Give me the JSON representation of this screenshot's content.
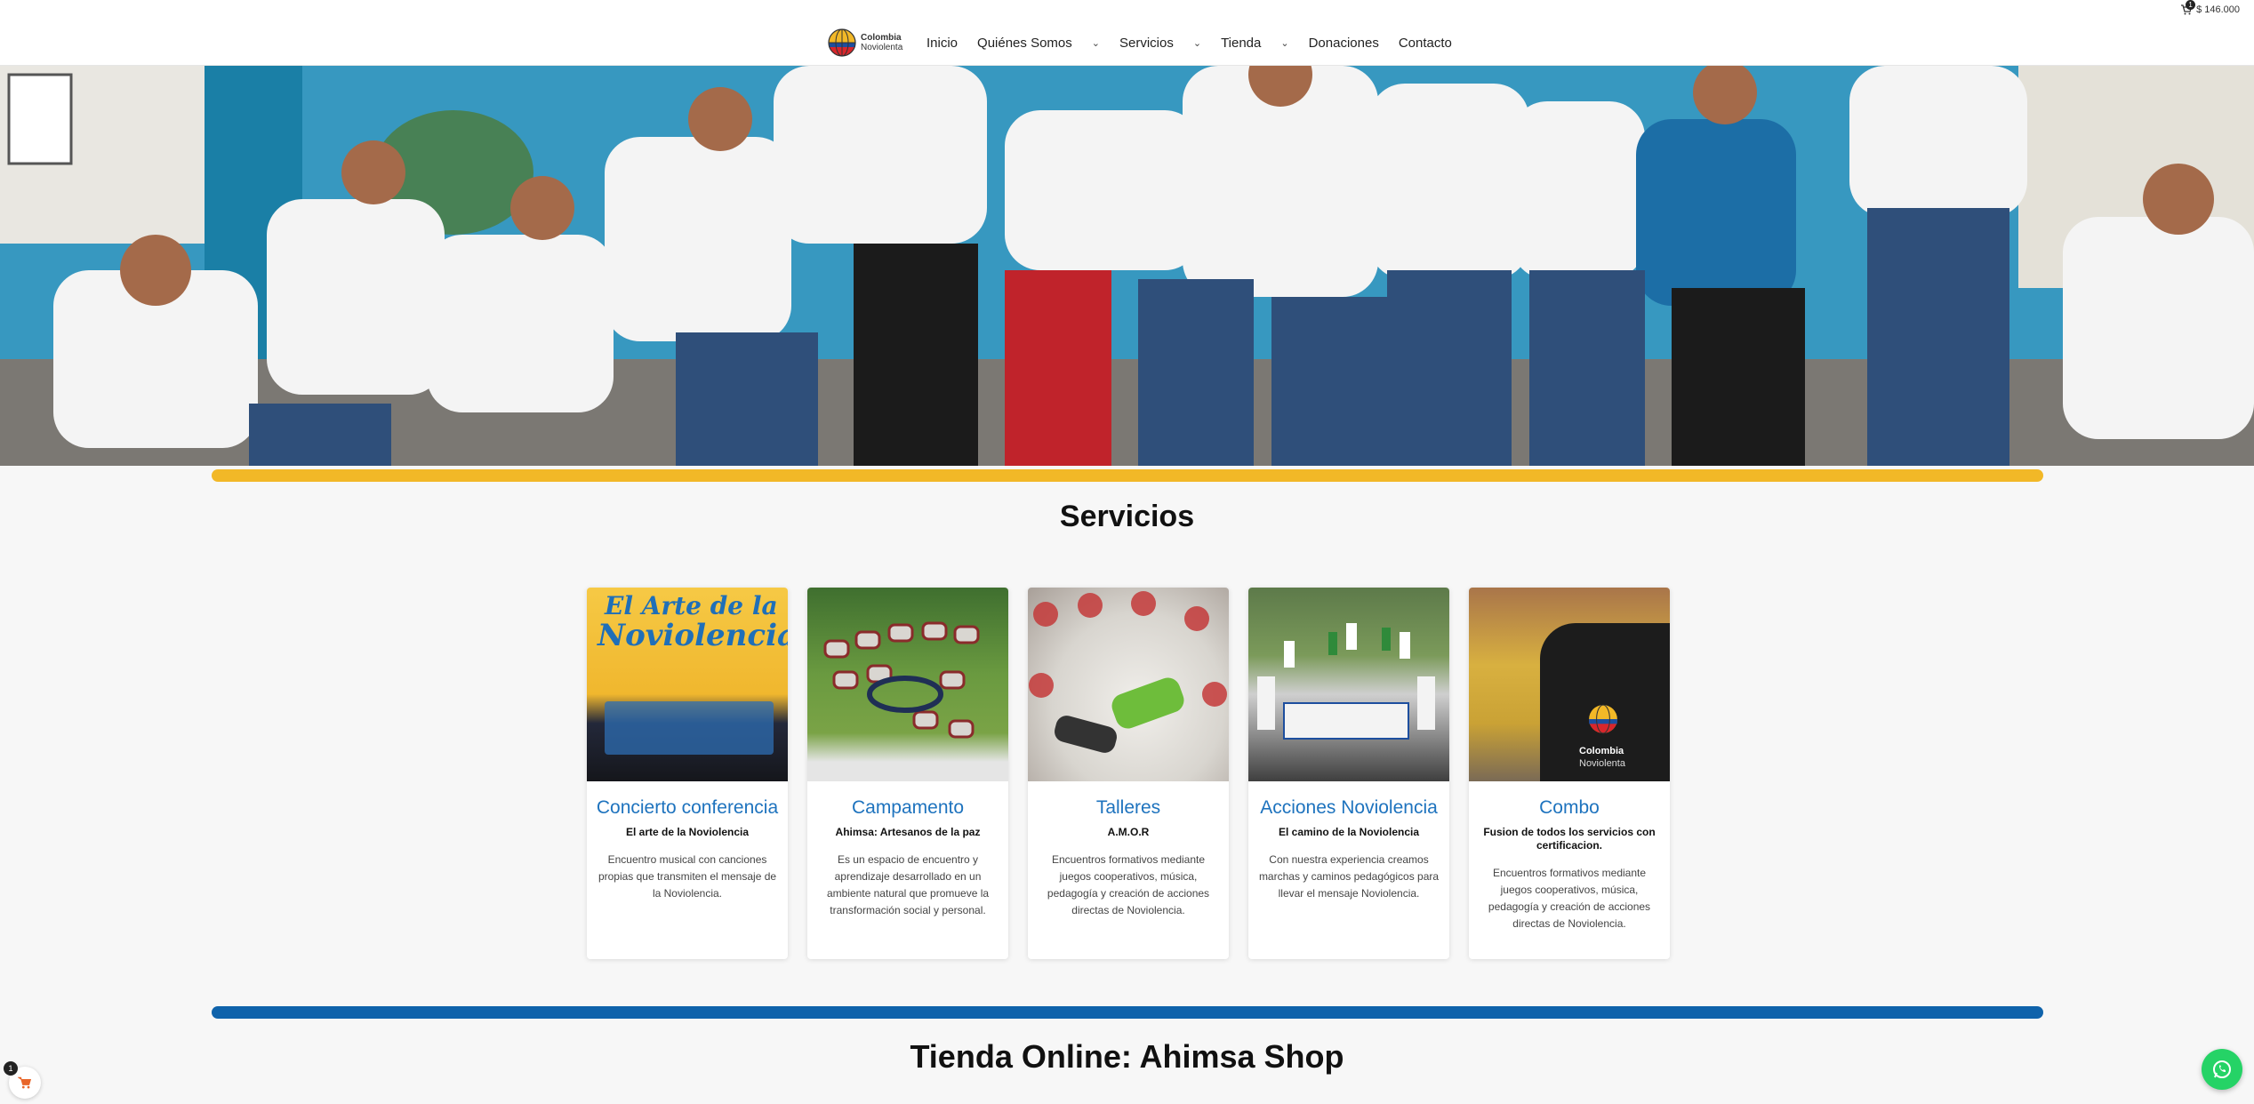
{
  "header": {
    "logo_line1": "Colombia",
    "logo_line2": "Noviolenta",
    "nav": [
      {
        "label": "Inicio"
      },
      {
        "label": "Quiénes Somos"
      },
      {
        "label": "Servicios"
      },
      {
        "label": "Tienda"
      },
      {
        "label": "Donaciones"
      },
      {
        "label": "Contacto"
      }
    ],
    "cart_count": "1",
    "cart_total": "$ 146.000"
  },
  "sections": {
    "servicios_title": "Servicios",
    "tienda_title": "Tienda Online: Ahimsa Shop"
  },
  "cards": [
    {
      "title": "Concierto conferencia",
      "subtitle": "El arte de la Noviolencia",
      "description": "Encuentro musical con canciones propias que transmiten el mensaje de la Noviolencia.",
      "image_text_1": "El Arte de la",
      "image_text_2": "Noviolencia"
    },
    {
      "title": "Campamento",
      "subtitle": "Ahimsa: Artesanos de la paz",
      "description": "Es un espacio de encuentro y aprendizaje desarrollado en un ambiente natural que promueve la transformación social y personal."
    },
    {
      "title": "Talleres",
      "subtitle": "A.M.O.R",
      "description": "Encuentros formativos mediante juegos cooperativos, música, pedagogía y creación de acciones directas de Noviolencia."
    },
    {
      "title": "Acciones Noviolencia",
      "subtitle": "El camino de la Noviolencia",
      "description": "Con nuestra experiencia creamos marchas y caminos pedagógicos para llevar el mensaje Noviolencia."
    },
    {
      "title": "Combo",
      "subtitle": "Fusion de todos los servicios con certificacion.",
      "description": "Encuentros formativos mediante juegos cooperativos, música, pedagogía y creación de acciones directas de Noviolencia.",
      "image_text_1": "Colombia",
      "image_text_2": "Noviolenta"
    }
  ],
  "floating": {
    "cart_count": "1"
  },
  "colors": {
    "accent_yellow": "#f2b827",
    "accent_blue": "#0f63ab",
    "card_title": "#1e73be",
    "whatsapp": "#25d366"
  },
  "icons": [
    "cart-icon",
    "chevron-down-icon",
    "whatsapp-icon",
    "globe-logo-icon"
  ]
}
